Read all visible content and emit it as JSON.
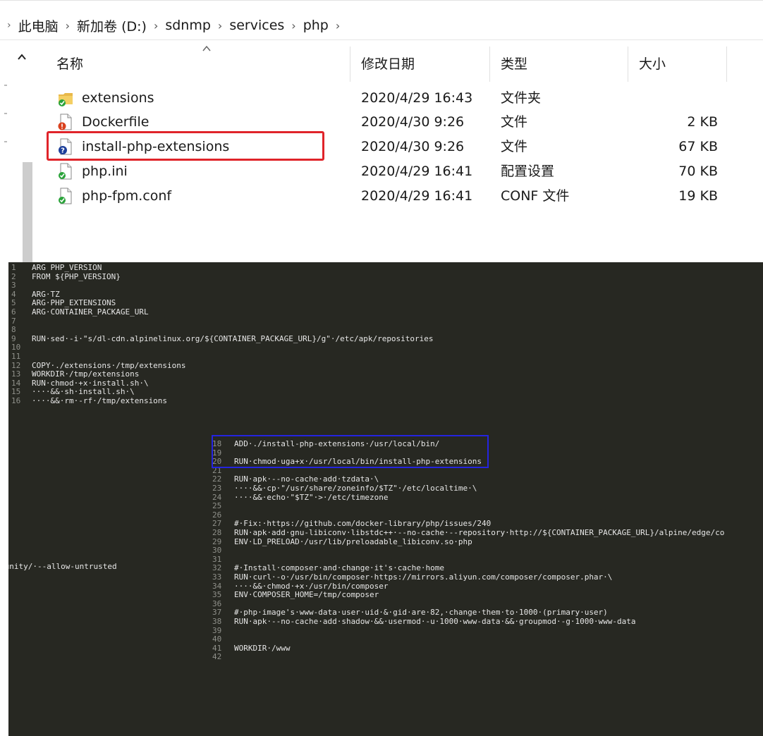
{
  "breadcrumb": {
    "lead": "›",
    "items": [
      "此电脑",
      "新加卷 (D:)",
      "sdnmp",
      "services",
      "php"
    ],
    "separator": "›",
    "trail": "›"
  },
  "columns": {
    "name": "名称",
    "date": "修改日期",
    "type": "类型",
    "size": "大小",
    "sort_indicator": "^"
  },
  "files": [
    {
      "name": "extensions",
      "date": "2020/4/29 16:43",
      "type": "文件夹",
      "size": "",
      "icon": "folder-icon"
    },
    {
      "name": "Dockerfile",
      "date": "2020/4/30 9:26",
      "type": "文件",
      "size": "2 KB",
      "icon": "file-warning-icon"
    },
    {
      "name": "install-php-extensions",
      "date": "2020/4/30 9:26",
      "type": "文件",
      "size": "67 KB",
      "icon": "file-question-icon"
    },
    {
      "name": "php.ini",
      "date": "2020/4/29 16:41",
      "type": "配置设置",
      "size": "70 KB",
      "icon": "file-check-icon"
    },
    {
      "name": "php-fpm.conf",
      "date": "2020/4/29 16:41",
      "type": "CONF 文件",
      "size": "19 KB",
      "icon": "file-check-icon"
    }
  ],
  "editor1": {
    "lines": [
      {
        "n": "1",
        "t": "ARG PHP_VERSION"
      },
      {
        "n": "2",
        "t": "FROM ${PHP_VERSION}"
      },
      {
        "n": "3",
        "t": ""
      },
      {
        "n": "4",
        "t": "ARG·TZ"
      },
      {
        "n": "5",
        "t": "ARG·PHP_EXTENSIONS"
      },
      {
        "n": "6",
        "t": "ARG·CONTAINER_PACKAGE_URL"
      },
      {
        "n": "7",
        "t": ""
      },
      {
        "n": "8",
        "t": ""
      },
      {
        "n": "9",
        "t": "RUN·sed·-i·\"s/dl-cdn.alpinelinux.org/${CONTAINER_PACKAGE_URL}/g\"·/etc/apk/repositories"
      },
      {
        "n": "10",
        "t": ""
      },
      {
        "n": "11",
        "t": ""
      },
      {
        "n": "12",
        "t": "COPY·./extensions·/tmp/extensions"
      },
      {
        "n": "13",
        "t": "WORKDIR·/tmp/extensions"
      },
      {
        "n": "14",
        "t": "RUN·chmod·+x·install.sh·\\"
      },
      {
        "n": "15",
        "t": "····&&·sh·install.sh·\\"
      },
      {
        "n": "16",
        "t": "····&&·rm·-rf·/tmp/extensions"
      }
    ]
  },
  "editor2": {
    "left_fragment": "munity/·--allow-untrusted",
    "lines": [
      {
        "n": "18",
        "t": "ADD·./install-php-extensions·/usr/local/bin/"
      },
      {
        "n": "19",
        "t": ""
      },
      {
        "n": "20",
        "t": "RUN·chmod·uga+x·/usr/local/bin/install-php-extensions"
      },
      {
        "n": "21",
        "t": ""
      },
      {
        "n": "22",
        "t": "RUN·apk·--no-cache·add·tzdata·\\"
      },
      {
        "n": "23",
        "t": "····&&·cp·\"/usr/share/zoneinfo/$TZ\"·/etc/localtime·\\"
      },
      {
        "n": "24",
        "t": "····&&·echo·\"$TZ\"·>·/etc/timezone"
      },
      {
        "n": "25",
        "t": ""
      },
      {
        "n": "26",
        "t": ""
      },
      {
        "n": "27",
        "t": "#·Fix:·https://github.com/docker-library/php/issues/240"
      },
      {
        "n": "28",
        "t": "RUN·apk·add·gnu-libiconv·libstdc++·--no-cache·--repository·http://${CONTAINER_PACKAGE_URL}/alpine/edge/co"
      },
      {
        "n": "29",
        "t": "ENV·LD_PRELOAD·/usr/lib/preloadable_libiconv.so·php"
      },
      {
        "n": "30",
        "t": ""
      },
      {
        "n": "31",
        "t": ""
      },
      {
        "n": "32",
        "t": "#·Install·composer·and·change·it's·cache·home"
      },
      {
        "n": "33",
        "t": "RUN·curl·-o·/usr/bin/composer·https://mirrors.aliyun.com/composer/composer.phar·\\"
      },
      {
        "n": "34",
        "t": "····&&·chmod·+x·/usr/bin/composer"
      },
      {
        "n": "35",
        "t": "ENV·COMPOSER_HOME=/tmp/composer"
      },
      {
        "n": "36",
        "t": ""
      },
      {
        "n": "37",
        "t": "#·php·image's·www-data·user·uid·&·gid·are·82,·change·them·to·1000·(primary·user)"
      },
      {
        "n": "38",
        "t": "RUN·apk·--no-cache·add·shadow·&&·usermod·-u·1000·www-data·&&·groupmod·-g·1000·www-data"
      },
      {
        "n": "39",
        "t": ""
      },
      {
        "n": "40",
        "t": ""
      },
      {
        "n": "41",
        "t": "WORKDIR·/www"
      },
      {
        "n": "42",
        "t": ""
      }
    ]
  }
}
